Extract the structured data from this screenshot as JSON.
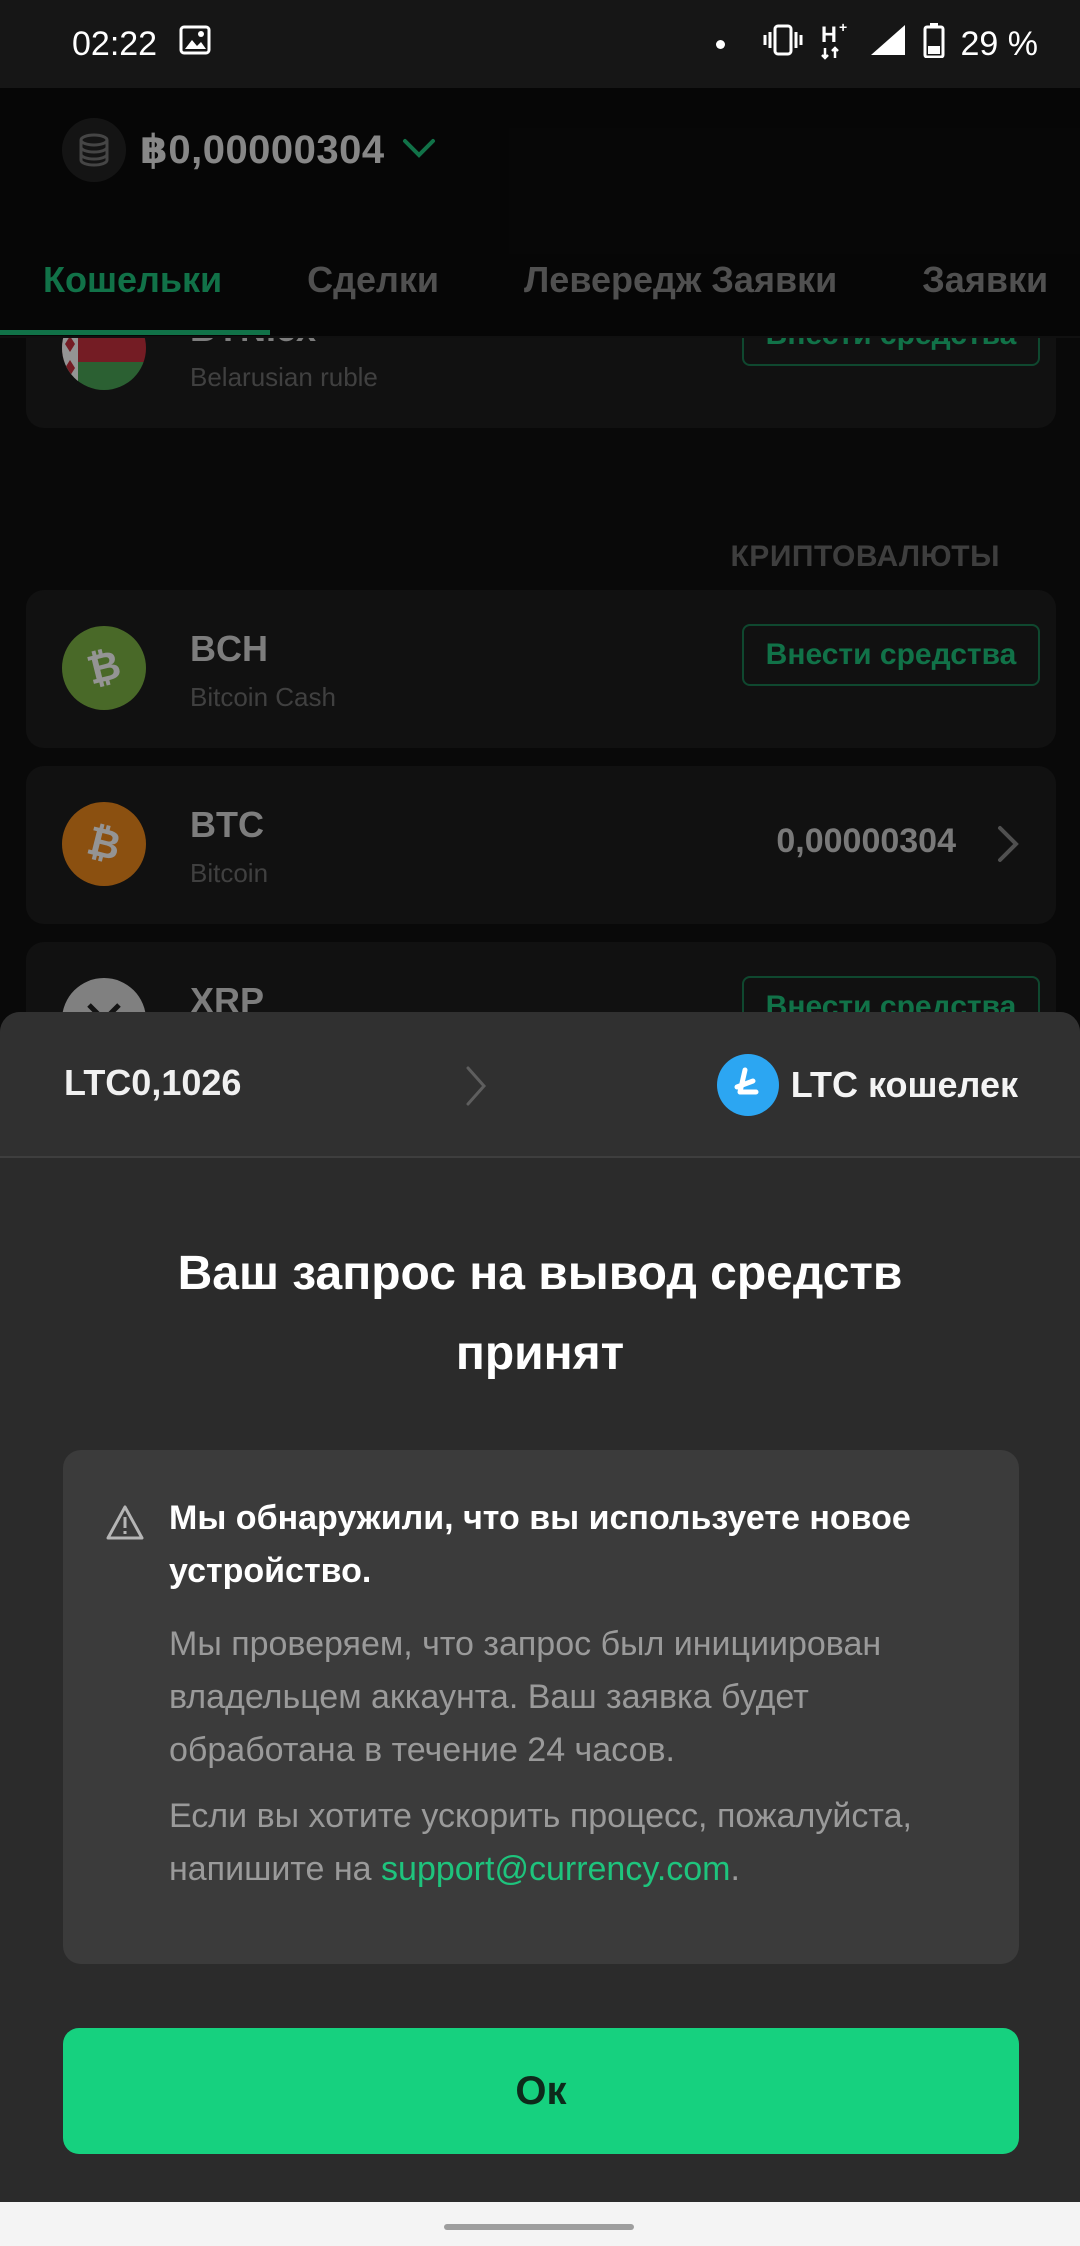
{
  "status_bar": {
    "time": "02:22",
    "battery": "29 %",
    "network": "H+",
    "icons": [
      "gallery-icon",
      "dot-icon",
      "vibrate-icon",
      "network-h-plus-icon",
      "signal-icon",
      "battery-icon"
    ]
  },
  "header": {
    "balance": "฿0,00000304"
  },
  "tabs": [
    {
      "label": "Кошельки",
      "active": true
    },
    {
      "label": "Сделки",
      "active": false
    },
    {
      "label": "Левередж Заявки",
      "active": false
    },
    {
      "label": "Заявки",
      "active": false
    }
  ],
  "wallets": {
    "fiat_card": {
      "title": "BYN.cx",
      "subtitle": "Belarusian ruble",
      "action": "Внести средства"
    },
    "section_title": "КРИПТОВАЛЮТЫ",
    "bch": {
      "title": "BCH",
      "subtitle": "Bitcoin Cash",
      "action": "Внести средства"
    },
    "btc": {
      "title": "BTC",
      "subtitle": "Bitcoin",
      "amount": "0,00000304"
    },
    "xrp": {
      "title": "XRP",
      "action": "Внести средства"
    }
  },
  "sheet": {
    "amount": "LTC0,1026",
    "wallet_label": "LTC кошелек",
    "title": "Ваш запрос на вывод средств принят",
    "notice": {
      "heading": "Мы обнаружили, что вы используете новое устройство.",
      "paragraph1": "Мы проверяем, что запрос был инициирован владельцем аккаунта. Ваш заявка будет обработана в течение 24 часов.",
      "paragraph2_prefix": "Если вы хотите ускорить процесс, пожалуйста, напишите на ",
      "email": "support@currency.com",
      "paragraph2_suffix": "."
    },
    "ok_label": "Ок"
  },
  "colors": {
    "accent": "#1ec47d",
    "button": "#16d17f",
    "sheet_bg": "#2b2b2b",
    "notice_bg": "#3b3b3b",
    "ltc_blue": "#2ca6f2",
    "btc_orange": "#f08a1d",
    "bch_green": "#7fb545"
  }
}
